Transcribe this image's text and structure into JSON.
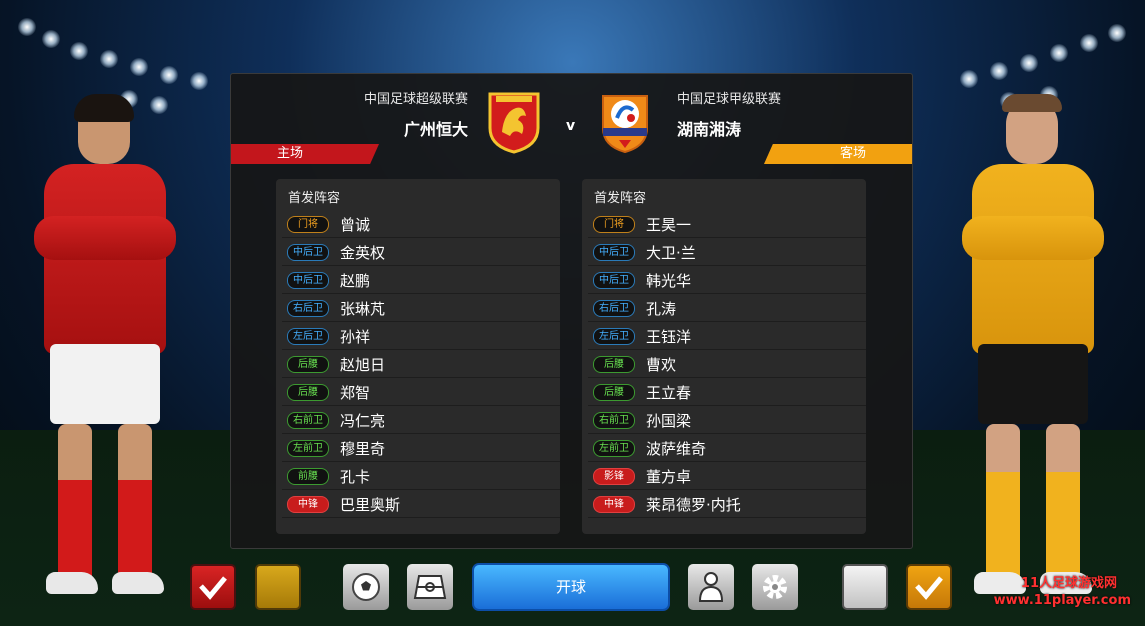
{
  "match": {
    "home": {
      "league": "中国足球超级联赛",
      "team": "广州恒大",
      "side_label": "主场",
      "color": "#c3161c"
    },
    "away": {
      "league": "中国足球甲级联赛",
      "team": "湖南湘涛",
      "side_label": "客场",
      "color": "#f2a110"
    },
    "vs": "v"
  },
  "lineups": {
    "title": "首发阵容",
    "home": [
      {
        "pos": "门将",
        "role": "gk",
        "name": "曾诚"
      },
      {
        "pos": "中后卫",
        "role": "df",
        "name": "金英权"
      },
      {
        "pos": "中后卫",
        "role": "df",
        "name": "赵鹏"
      },
      {
        "pos": "右后卫",
        "role": "df",
        "name": "张琳芃"
      },
      {
        "pos": "左后卫",
        "role": "df",
        "name": "孙祥"
      },
      {
        "pos": "后腰",
        "role": "mf",
        "name": "赵旭日"
      },
      {
        "pos": "后腰",
        "role": "mf",
        "name": "郑智"
      },
      {
        "pos": "右前卫",
        "role": "mf",
        "name": "冯仁亮"
      },
      {
        "pos": "左前卫",
        "role": "mf",
        "name": "穆里奇"
      },
      {
        "pos": "前腰",
        "role": "mf",
        "name": "孔卡"
      },
      {
        "pos": "中锋",
        "role": "fw",
        "name": "巴里奥斯"
      }
    ],
    "away": [
      {
        "pos": "门将",
        "role": "gk",
        "name": "王昊一"
      },
      {
        "pos": "中后卫",
        "role": "df",
        "name": "大卫·兰"
      },
      {
        "pos": "中后卫",
        "role": "df",
        "name": "韩光华"
      },
      {
        "pos": "右后卫",
        "role": "df",
        "name": "孔涛"
      },
      {
        "pos": "左后卫",
        "role": "df",
        "name": "王钰洋"
      },
      {
        "pos": "后腰",
        "role": "mf",
        "name": "曹欢"
      },
      {
        "pos": "后腰",
        "role": "mf",
        "name": "王立春"
      },
      {
        "pos": "右前卫",
        "role": "mf",
        "name": "孙国梁"
      },
      {
        "pos": "左前卫",
        "role": "mf",
        "name": "波萨维奇"
      },
      {
        "pos": "影锋",
        "role": "fw",
        "name": "董方卓"
      },
      {
        "pos": "中锋",
        "role": "fw",
        "name": "莱昂德罗·内托"
      }
    ]
  },
  "toolbar": {
    "kickoff_label": "开球",
    "icons": [
      "check-icon",
      "kit-color-swatch",
      "ball-icon",
      "formation-icon",
      "manager-icon",
      "gear-icon",
      "kit-color-swatch",
      "check-icon"
    ]
  },
  "watermark": {
    "line1": "11人足球游戏网",
    "line2": "www.11player.com"
  }
}
